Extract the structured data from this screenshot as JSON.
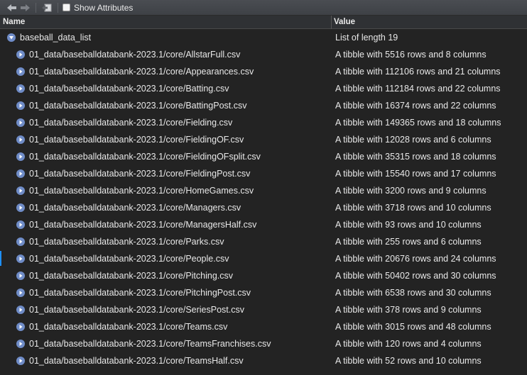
{
  "toolbar": {
    "back_icon": "back-arrow-icon",
    "forward_icon": "forward-arrow-icon",
    "export_icon": "export-icon",
    "show_attributes_label": "Show Attributes",
    "show_attributes_checked": false
  },
  "header": {
    "name_label": "Name",
    "value_label": "Value"
  },
  "root": {
    "name": "baseball_data_list",
    "value": "List of length 19",
    "expanded": true
  },
  "items": [
    {
      "name": "01_data/baseballdatabank-2023.1/core/AllstarFull.csv",
      "value": "A tibble with 5516 rows and 8 columns"
    },
    {
      "name": "01_data/baseballdatabank-2023.1/core/Appearances.csv",
      "value": "A tibble with 112106 rows and 21 columns"
    },
    {
      "name": "01_data/baseballdatabank-2023.1/core/Batting.csv",
      "value": "A tibble with 112184 rows and 22 columns"
    },
    {
      "name": "01_data/baseballdatabank-2023.1/core/BattingPost.csv",
      "value": "A tibble with 16374 rows and 22 columns"
    },
    {
      "name": "01_data/baseballdatabank-2023.1/core/Fielding.csv",
      "value": "A tibble with 149365 rows and 18 columns"
    },
    {
      "name": "01_data/baseballdatabank-2023.1/core/FieldingOF.csv",
      "value": "A tibble with 12028 rows and 6 columns"
    },
    {
      "name": "01_data/baseballdatabank-2023.1/core/FieldingOFsplit.csv",
      "value": "A tibble with 35315 rows and 18 columns"
    },
    {
      "name": "01_data/baseballdatabank-2023.1/core/FieldingPost.csv",
      "value": "A tibble with 15540 rows and 17 columns"
    },
    {
      "name": "01_data/baseballdatabank-2023.1/core/HomeGames.csv",
      "value": "A tibble with 3200 rows and 9 columns"
    },
    {
      "name": "01_data/baseballdatabank-2023.1/core/Managers.csv",
      "value": "A tibble with 3718 rows and 10 columns"
    },
    {
      "name": "01_data/baseballdatabank-2023.1/core/ManagersHalf.csv",
      "value": "A tibble with 93 rows and 10 columns"
    },
    {
      "name": "01_data/baseballdatabank-2023.1/core/Parks.csv",
      "value": "A tibble with 255 rows and 6 columns"
    },
    {
      "name": "01_data/baseballdatabank-2023.1/core/People.csv",
      "value": "A tibble with 20676 rows and 24 columns"
    },
    {
      "name": "01_data/baseballdatabank-2023.1/core/Pitching.csv",
      "value": "A tibble with 50402 rows and 30 columns"
    },
    {
      "name": "01_data/baseballdatabank-2023.1/core/PitchingPost.csv",
      "value": "A tibble with 6538 rows and 30 columns"
    },
    {
      "name": "01_data/baseballdatabank-2023.1/core/SeriesPost.csv",
      "value": "A tibble with 378 rows and 9 columns"
    },
    {
      "name": "01_data/baseballdatabank-2023.1/core/Teams.csv",
      "value": "A tibble with 3015 rows and 48 columns"
    },
    {
      "name": "01_data/baseballdatabank-2023.1/core/TeamsFranchises.csv",
      "value": "A tibble with 120 rows and 4 columns"
    },
    {
      "name": "01_data/baseballdatabank-2023.1/core/TeamsHalf.csv",
      "value": "A tibble with 52 rows and 10 columns"
    }
  ],
  "colors": {
    "background": "#232323",
    "toolbar": "#44474c",
    "header": "#2f3134",
    "text": "#e8e8e8",
    "expander": "#6f8cc7",
    "focus": "#1e90ff"
  }
}
